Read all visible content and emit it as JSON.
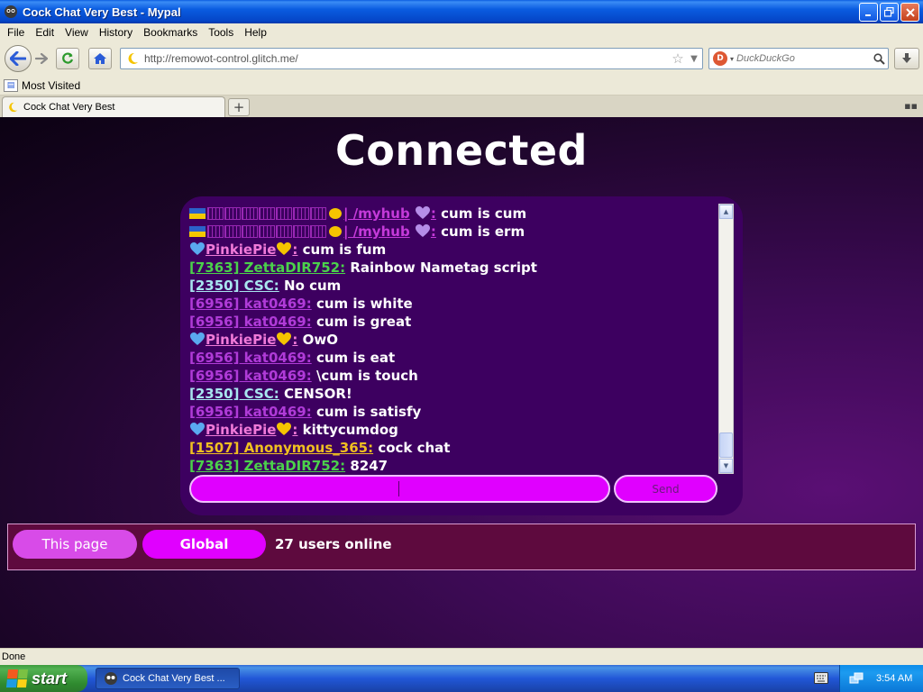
{
  "window": {
    "title": "Cock Chat Very Best - Mypal",
    "controls": [
      "minimize",
      "maximize",
      "close"
    ]
  },
  "menu": [
    "File",
    "Edit",
    "View",
    "History",
    "Bookmarks",
    "Tools",
    "Help"
  ],
  "nav": {
    "url": "http://remowot-control.glitch.me/",
    "search_placeholder": "DuckDuckGo"
  },
  "bookmarks": {
    "most_visited": "Most Visited"
  },
  "tabs": [
    {
      "label": "Cock Chat Very Best"
    }
  ],
  "page": {
    "heading": "Connected",
    "messages": [
      {
        "style": "myhub",
        "name": "| /myhub",
        "text": "cum is cum",
        "color": "#c43ad9"
      },
      {
        "style": "myhub",
        "name": "| /myhub",
        "text": "cum is erm",
        "color": "#c43ad9"
      },
      {
        "style": "pinkie",
        "name": "PinkiePie",
        "text": "cum is fum",
        "color": "#f07ad8"
      },
      {
        "style": "plain",
        "name": "[7363] ZettaDIR752:",
        "text": "Rainbow Nametag script",
        "color": "#4bd14b"
      },
      {
        "style": "plain",
        "name": "[2350] CSC:",
        "text": "No cum",
        "color": "#a8e6ef"
      },
      {
        "style": "plain",
        "name": "[6956] kat0469:",
        "text": "cum is white",
        "color": "#b03bd8"
      },
      {
        "style": "plain",
        "name": "[6956] kat0469:",
        "text": "cum is great",
        "color": "#b03bd8"
      },
      {
        "style": "pinkie",
        "name": "PinkiePie",
        "text": "OwO",
        "color": "#f07ad8"
      },
      {
        "style": "plain",
        "name": "[6956] kat0469:",
        "text": "cum is eat",
        "color": "#b03bd8"
      },
      {
        "style": "plain",
        "name": "[6956] kat0469:",
        "text": "\\cum is touch",
        "color": "#b03bd8"
      },
      {
        "style": "plain",
        "name": "[2350] CSC:",
        "text": "CENSOR!",
        "color": "#a8e6ef"
      },
      {
        "style": "plain",
        "name": "[6956] kat0469:",
        "text": "cum is satisfy",
        "color": "#b03bd8"
      },
      {
        "style": "pinkie",
        "name": "PinkiePie",
        "text": "kittycumdog",
        "color": "#f07ad8"
      },
      {
        "style": "plain",
        "name": "[1507] Anonymous_365:",
        "text": "cock chat",
        "color": "#f0c020"
      },
      {
        "style": "plain",
        "name": "[7363] ZettaDIR752:",
        "text": "8247",
        "color": "#4bd14b"
      }
    ],
    "input_value": "",
    "send_label": "Send",
    "tabs": {
      "this_page": "This page",
      "global": "Global"
    },
    "users_online": "27 users online"
  },
  "status": {
    "text": "Done"
  },
  "taskbar": {
    "start": "start",
    "task": "Cock Chat Very Best ...",
    "clock": "3:54 AM"
  },
  "colors": {
    "accent": "#e000ff",
    "panel": "#3d0060",
    "footer_panel": "#5e0a3e"
  }
}
